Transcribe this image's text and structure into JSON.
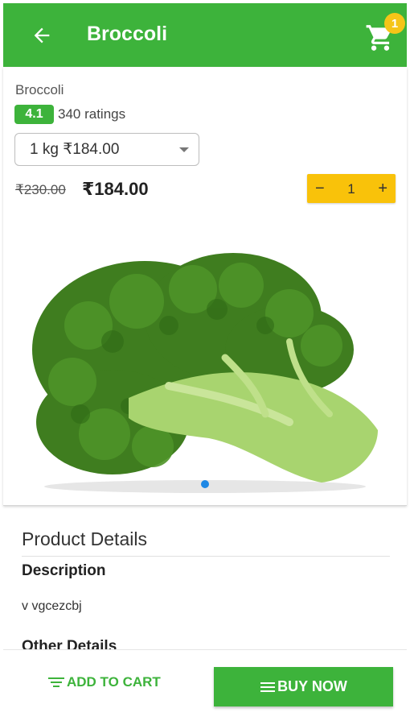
{
  "header": {
    "title": "Broccoli",
    "cart_count": "1",
    "colors": {
      "primary": "#3db33b",
      "badge": "#f5c518"
    }
  },
  "product": {
    "name": "Broccoli",
    "rating": "4.1",
    "ratings_count": "340 ratings",
    "selected_variant": "1 kg ₹184.00",
    "price_old": "₹230.00",
    "price_new": "₹184.00",
    "quantity": "1",
    "image_pager": {
      "pages": 1,
      "current": 1
    }
  },
  "details": {
    "title": "Product Details",
    "description_heading": "Description",
    "description_text": "v vgcezcbj",
    "other_heading": "Other Details"
  },
  "actions": {
    "add_to_cart": "ADD TO CART",
    "buy_now": "BUY NOW"
  }
}
